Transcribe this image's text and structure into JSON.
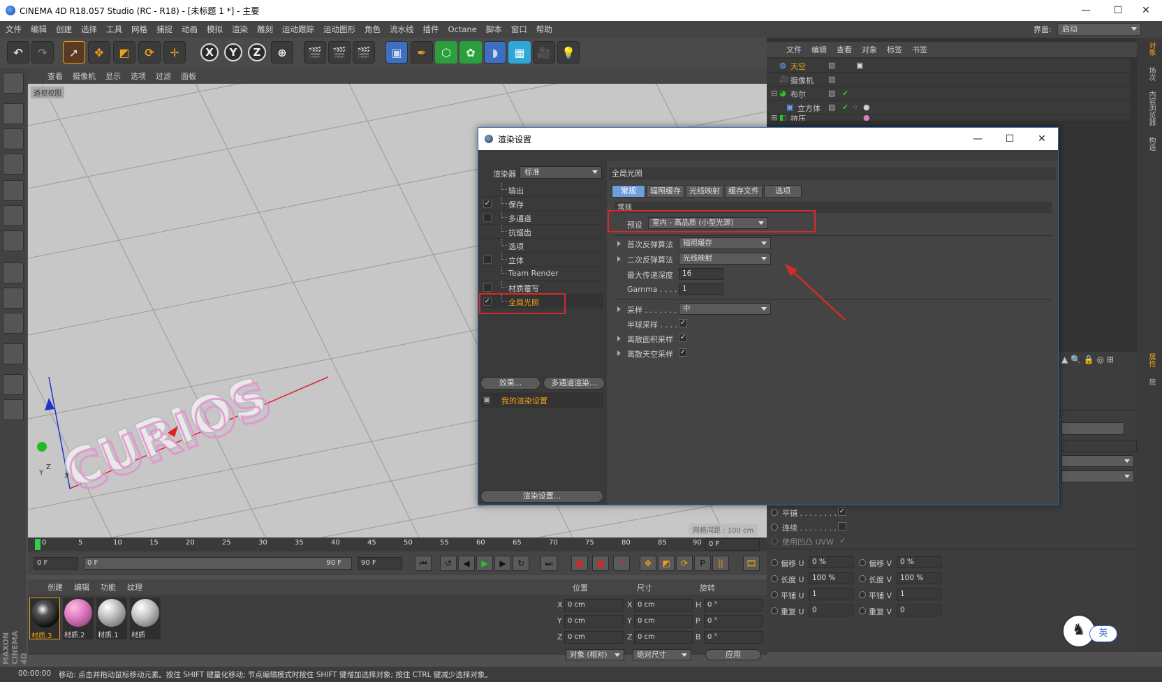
{
  "app": {
    "title": "CINEMA 4D R18.057 Studio (RC - R18) - [未标题 1 *] - 主要",
    "menu": [
      "文件",
      "编辑",
      "创建",
      "选择",
      "工具",
      "网格",
      "捕捉",
      "动画",
      "模拟",
      "渲染",
      "雕刻",
      "运动跟踪",
      "运动图形",
      "角色",
      "流水线",
      "插件",
      "Octane",
      "脚本",
      "窗口",
      "帮助"
    ],
    "layout_label": "界面:",
    "layout_value": "启动"
  },
  "toolbar": {
    "axis_x": "X",
    "axis_y": "Y",
    "axis_z": "Z"
  },
  "viewport": {
    "menu": [
      "查看",
      "摄像机",
      "显示",
      "选项",
      "过滤",
      "面板"
    ],
    "label": "透视视图",
    "grid_label": "网格间距 : 100 cm",
    "text": "CURIOS",
    "axis_labels": {
      "y": "Y",
      "z": "Z",
      "x": "X"
    }
  },
  "timeline": {
    "ticks": [
      "0",
      "5",
      "10",
      "15",
      "20",
      "25",
      "30",
      "35",
      "40",
      "45",
      "50",
      "55",
      "60",
      "65",
      "70",
      "75",
      "80",
      "85",
      "90"
    ],
    "frame_right": "0 F",
    "start": "0 F",
    "range_start": "0 F",
    "range_end": "90 F",
    "end": "90 F"
  },
  "materials": {
    "menu": [
      "创建",
      "编辑",
      "功能",
      "纹理"
    ],
    "items": [
      {
        "name": "材质.3",
        "color": "#222"
      },
      {
        "name": "材质.2",
        "color": "#e07cc4"
      },
      {
        "name": "材质.1",
        "color": "#bdbdbd"
      },
      {
        "name": "材质",
        "color": "#c4c4c4"
      }
    ]
  },
  "coords": {
    "headers": [
      "位置",
      "尺寸",
      "旋转"
    ],
    "rows": [
      {
        "a": "X",
        "v1": "0 cm",
        "b": "X",
        "v2": "0 cm",
        "c": "H",
        "v3": "0 °"
      },
      {
        "a": "Y",
        "v1": "0 cm",
        "b": "Y",
        "v2": "0 cm",
        "c": "P",
        "v3": "0 °"
      },
      {
        "a": "Z",
        "v1": "0 cm",
        "b": "Z",
        "v2": "0 cm",
        "c": "B",
        "v3": "0 °"
      }
    ],
    "mode1": "对象 (相对)",
    "mode2": "绝对尺寸",
    "apply": "应用"
  },
  "status": {
    "time": "00:00:00",
    "message": "移动: 点击并拖动鼠标移动元素。按住 SHIFT 键量化移动; 节点编辑模式时按住 SHIFT 键增加选择对象; 按住 CTRL 键减少选择对象。"
  },
  "objects": {
    "menu": [
      "文件",
      "编辑",
      "查看",
      "对象",
      "标签",
      "书签"
    ],
    "rows": [
      {
        "name": "天空",
        "highlight": true
      },
      {
        "name": "摄像机",
        "highlight": false
      },
      {
        "name": "布尔",
        "highlight": false
      },
      {
        "name": "立方体",
        "highlight": false
      },
      {
        "name": "挤压",
        "highlight": false
      }
    ]
  },
  "right_tabs": [
    "对象",
    "场次",
    "内容浏览器",
    "构造",
    "属性",
    "层"
  ],
  "attributes": {
    "tile": "平铺 . . . . . . . .",
    "seamless": "连续 . . . . . . . .",
    "use_bump": "使用凹凸 UVW",
    "rows": [
      {
        "l1": "偏移 U",
        "v1": "0 %",
        "l2": "偏移 V",
        "v2": "0 %"
      },
      {
        "l1": "长度 U",
        "v1": "100 %",
        "l2": "长度 V",
        "v2": "100 %"
      },
      {
        "l1": "平铺 U",
        "v1": "1",
        "l2": "平铺 V",
        "v2": "1"
      },
      {
        "l1": "重复 U",
        "v1": "0",
        "l2": "重复 V",
        "v2": "0"
      }
    ]
  },
  "dialog": {
    "title": "渲染设置",
    "renderer_label": "渲染器",
    "renderer_value": "标准",
    "list": [
      {
        "label": "输出",
        "check": "none"
      },
      {
        "label": "保存",
        "check": "checked"
      },
      {
        "label": "多通道",
        "check": "empty"
      },
      {
        "label": "抗锯齿",
        "check": "none"
      },
      {
        "label": "选项",
        "check": "none"
      },
      {
        "label": "立体",
        "check": "empty"
      },
      {
        "label": "Team Render",
        "check": "none"
      },
      {
        "label": "材质覆写",
        "check": "empty"
      },
      {
        "label": "全局光照",
        "check": "checked",
        "active": true
      }
    ],
    "effects_btn": "效果...",
    "multipass_btn": "多通道渲染...",
    "my_settings": "我的渲染设置",
    "render_settings_btn": "渲染设置...",
    "section_title": "全局光照",
    "tabs": [
      "常规",
      "辐照缓存",
      "光线映射",
      "缓存文件",
      "选项"
    ],
    "sub_title": "常规",
    "preset_label": "预设",
    "preset_value": "室内 - 高品质 (小型光源)",
    "primary_label": "首次反弹算法",
    "primary_value": "辐照缓存",
    "secondary_label": "二次反弹算法",
    "secondary_value": "光线映射",
    "depth_label": "最大传递深度",
    "depth_value": "16",
    "gamma_label": "Gamma . . . .",
    "gamma_value": "1",
    "sampling_label": "采样 . . . . . . .",
    "sampling_value": "中",
    "hemi_label": "半球采样 . . . .",
    "area_label": "离散面积采样",
    "sky_label": "离散天空采样"
  },
  "badge": {
    "lang": "英"
  },
  "brand": {
    "maxon": "MAXON",
    "c4d": "CINEMA 4D"
  },
  "colors": {
    "accent_orange": "#f2a017",
    "highlight_red": "#d62a2a",
    "tab_active": "#6e9fdc"
  }
}
